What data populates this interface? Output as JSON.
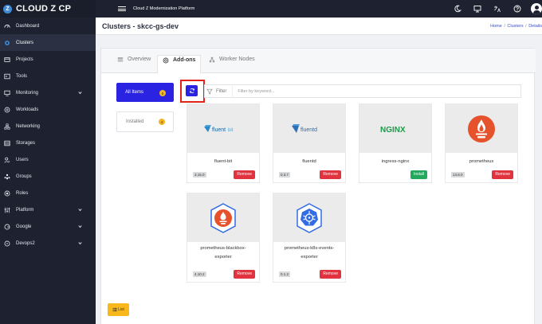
{
  "brand": {
    "logo_letter": "Z",
    "name": "CLOUD Z CP"
  },
  "topbar": {
    "title": "Cloud Z Modernization Platform",
    "icons": [
      "moon-icon",
      "monitor-icon",
      "language-icon",
      "help-icon",
      "user-avatar"
    ]
  },
  "sidebar": {
    "items": [
      {
        "label": "Dashboard",
        "icon": "dashboard-icon",
        "chevron": false,
        "active": false
      },
      {
        "label": "Clusters",
        "icon": "clusters-icon",
        "chevron": false,
        "active": true
      },
      {
        "label": "Projects",
        "icon": "projects-icon",
        "chevron": false,
        "active": false
      },
      {
        "label": "Tools",
        "icon": "tools-icon",
        "chevron": false,
        "active": false
      },
      {
        "label": "Monitoring",
        "icon": "monitoring-icon",
        "chevron": true,
        "active": false
      },
      {
        "label": "Workloads",
        "icon": "workloads-icon",
        "chevron": false,
        "active": false
      },
      {
        "label": "Networking",
        "icon": "networking-icon",
        "chevron": false,
        "active": false
      },
      {
        "label": "Storages",
        "icon": "storages-icon",
        "chevron": false,
        "active": false
      },
      {
        "label": "Users",
        "icon": "users-icon",
        "chevron": false,
        "active": false
      },
      {
        "label": "Groups",
        "icon": "groups-icon",
        "chevron": false,
        "active": false
      },
      {
        "label": "Roles",
        "icon": "roles-icon",
        "chevron": false,
        "active": false
      },
      {
        "label": "Platform",
        "icon": "platform-icon",
        "chevron": true,
        "active": false
      },
      {
        "label": "Google",
        "icon": "google-icon",
        "chevron": true,
        "active": false
      },
      {
        "label": "Devops2",
        "icon": "devops-icon",
        "chevron": true,
        "active": false
      }
    ]
  },
  "page": {
    "title": "Clusters - skcc-gs-dev",
    "breadcrumb": [
      "Home",
      "Clusters",
      "Details"
    ]
  },
  "tabs": [
    {
      "label": "Overview",
      "icon": "overview-icon",
      "active": false
    },
    {
      "label": "Add-ons",
      "icon": "addons-icon",
      "active": true
    },
    {
      "label": "Worker Nodes",
      "icon": "worker-nodes-icon",
      "active": false
    }
  ],
  "filters": {
    "all": {
      "label": "All Items",
      "count": "5"
    },
    "installed": {
      "label": "Installed",
      "count": "4"
    }
  },
  "search": {
    "filter_label": "Filter",
    "placeholder": "Filter by keyword...",
    "value": ""
  },
  "addons": [
    {
      "name": "fluent-bit",
      "version": "3.15.0",
      "action": "Remove",
      "logo": "fluentbit-logo",
      "logo_text": "fluent",
      "logo_text_suffix": "bit"
    },
    {
      "name": "fluentd",
      "version": "0.3.7",
      "action": "Remove",
      "logo": "fluentd-logo",
      "logo_text": "fluentd"
    },
    {
      "name": "ingress-nginx",
      "version": "",
      "action": "Install",
      "logo": "nginx-logo",
      "logo_text": "NGINX"
    },
    {
      "name": "prometheus",
      "version": "13.8.0",
      "action": "Remove",
      "logo": "prometheus-logo"
    },
    {
      "name_lines": [
        "prometheus-blackbox-",
        "exporter"
      ],
      "version": "4.10.2",
      "action": "Remove",
      "logo": "prometheus-blackbox-logo"
    },
    {
      "name_lines": [
        "prometheus-k8s-events-",
        "exporter"
      ],
      "version": "0.1.2",
      "action": "Remove",
      "logo": "kubernetes-logo"
    }
  ],
  "list_button": {
    "label": "List"
  },
  "colors": {
    "primary": "#2a24e2",
    "sidebar_bg": "#1e2230",
    "remove": "#e0333f",
    "install": "#22a95d",
    "badge": "#f3b622",
    "highlight": "#e22319"
  }
}
